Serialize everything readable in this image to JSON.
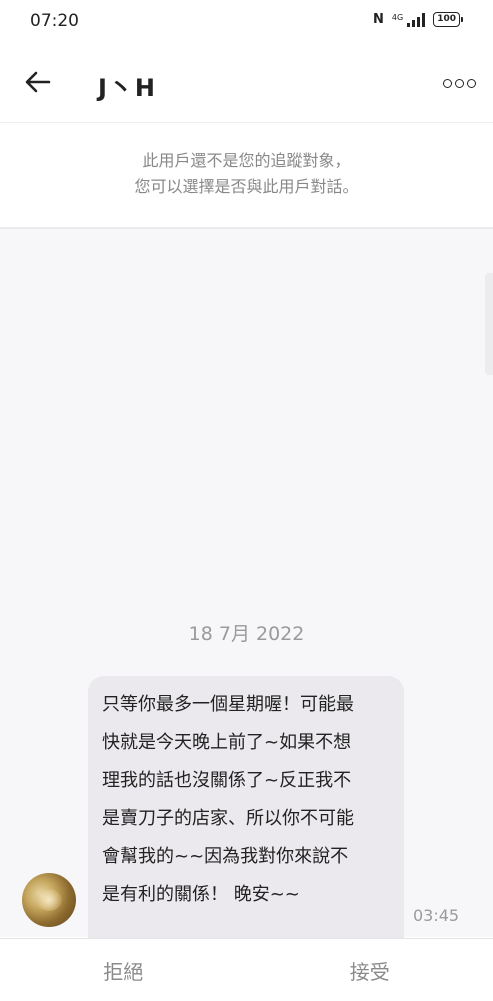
{
  "status_bar": {
    "time": "07:20",
    "nfc": "N",
    "network": "4G",
    "battery": "100"
  },
  "header": {
    "contact_name": "J丶H",
    "back_icon": "arrow-left-icon",
    "more_icon": "more-options-icon"
  },
  "notice": {
    "line1": "此用戶還不是您的追蹤對象，",
    "line2": "您可以選擇是否與此用戶對話。"
  },
  "chat": {
    "date": "18 7月 2022",
    "message": {
      "lines": [
        "只等你最多一個星期喔！可能最",
        "快就是今天晚上前了~如果不想",
        "理我的話也沒關係了~反正我不",
        "是賣刀子的店家、所以你不可能",
        "會幫我的~~因為我對你來說不",
        "是有利的關係！ 晚安~~"
      ],
      "time": "03:45"
    }
  },
  "actions": {
    "reject": "拒絕",
    "accept": "接受"
  }
}
